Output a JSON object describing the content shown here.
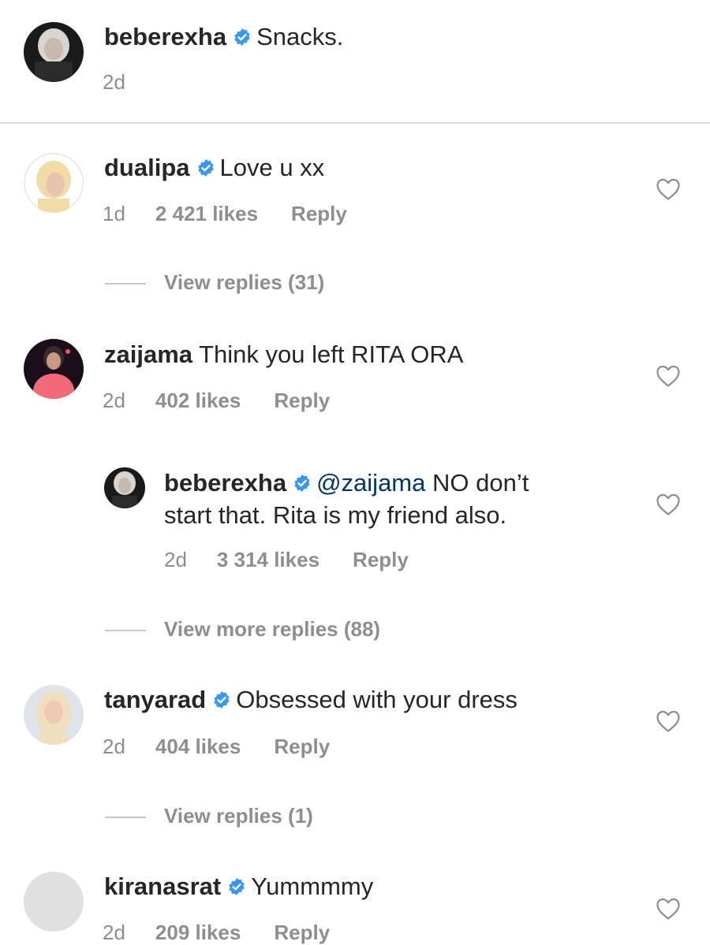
{
  "caption": {
    "username": "beberexha",
    "text": "Snacks.",
    "time": "2d"
  },
  "comments": [
    {
      "username": "dualipa",
      "text": "Love u xx",
      "time": "1d",
      "likes": "2 421 likes",
      "reply": "Reply",
      "view_replies": "View replies (31)",
      "avatar_icon": "avatar-dualipa"
    },
    {
      "username": "zaijama",
      "text": "Think you left RITA ORA",
      "time": "2d",
      "likes": "402 likes",
      "reply": "Reply",
      "avatar_icon": "avatar-zaijama"
    },
    {
      "username": "beberexha",
      "mention": "@zaijama",
      "text_line1": "NO don’t",
      "text_line2": "start that. Rita is my friend also.",
      "time": "2d",
      "likes": "3 314 likes",
      "reply": "Reply",
      "view_replies": "View more replies (88)",
      "avatar_icon": "avatar-beberexha"
    },
    {
      "username": "tanyarad",
      "text": "Obsessed with your dress",
      "time": "2d",
      "likes": "404 likes",
      "reply": "Reply",
      "view_replies": "View replies (1)",
      "avatar_icon": "avatar-tanyarad"
    },
    {
      "username": "kiranasrat",
      "text": "Yummmmy",
      "time": "2d",
      "likes": "209 likes",
      "reply": "Reply",
      "avatar_icon": "avatar-placeholder"
    }
  ],
  "colors": {
    "verified": "#3897f0",
    "secondary_text": "#8e8e8e",
    "mention": "#003569",
    "divider": "#dbdbdb"
  }
}
